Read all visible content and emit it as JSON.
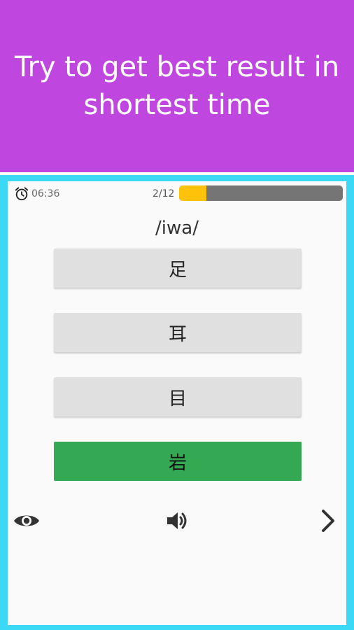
{
  "banner": {
    "headline": "Try to get best result in shortest time"
  },
  "quiz": {
    "timer": "06:36",
    "progress_label": "2/12",
    "progress_fraction": 0.1667,
    "word": "/iwa/",
    "options": [
      {
        "label": "足",
        "state": "default"
      },
      {
        "label": "耳",
        "state": "default"
      },
      {
        "label": "目",
        "state": "default"
      },
      {
        "label": "岩",
        "state": "correct"
      }
    ]
  },
  "colors": {
    "banner": "#c046e0",
    "frame": "#3bd9f5",
    "progress_fill": "#ffc20a",
    "progress_track": "#757575",
    "correct": "#34a853",
    "option": "#e0e0e0"
  },
  "icons": {
    "timer": "alarm-clock-icon",
    "reveal": "eye-icon",
    "audio": "speaker-icon",
    "next": "chevron-right-icon"
  }
}
